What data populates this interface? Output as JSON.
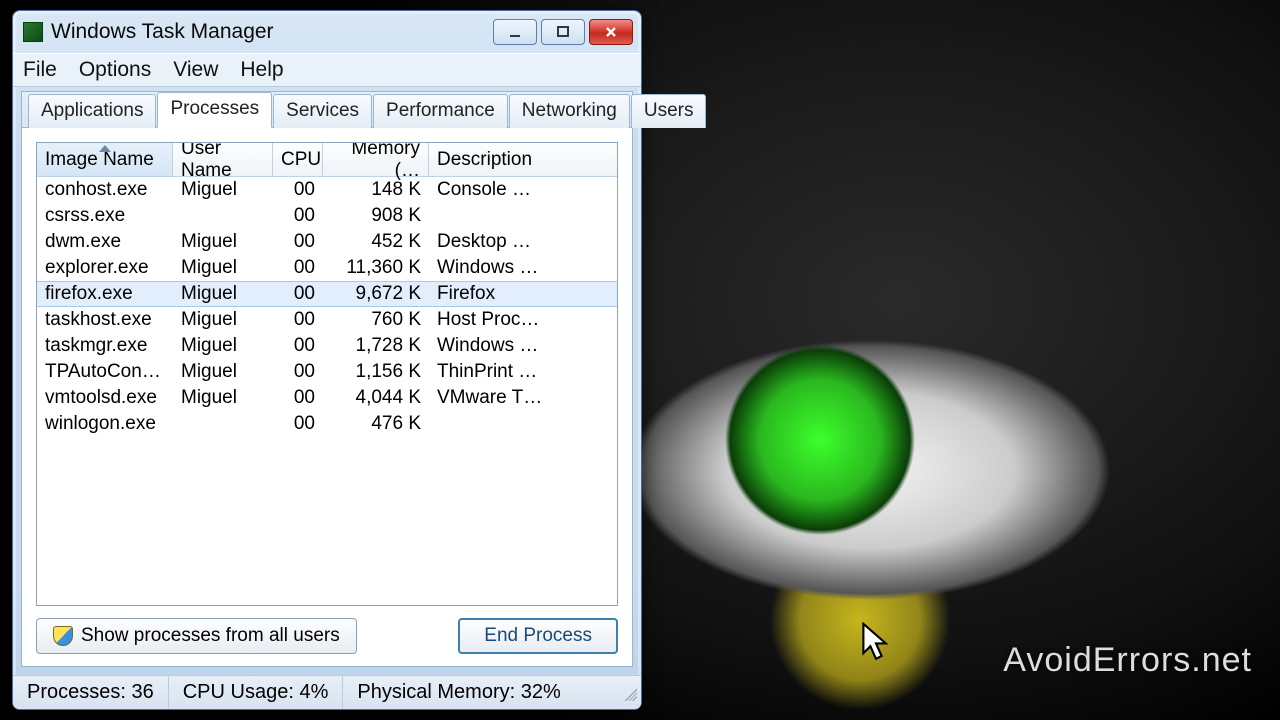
{
  "window": {
    "title": "Windows Task Manager"
  },
  "menu": {
    "file": "File",
    "options": "Options",
    "view": "View",
    "help": "Help"
  },
  "tabs": {
    "applications": "Applications",
    "processes": "Processes",
    "services": "Services",
    "performance": "Performance",
    "networking": "Networking",
    "users": "Users"
  },
  "columns": {
    "image": "Image Name",
    "user": "User Name",
    "cpu": "CPU",
    "memory": "Memory (…",
    "description": "Description"
  },
  "processes": [
    {
      "image": "conhost.exe",
      "user": "Miguel",
      "cpu": "00",
      "mem": "148 K",
      "desc": "Console …",
      "selected": false
    },
    {
      "image": "csrss.exe",
      "user": "",
      "cpu": "00",
      "mem": "908 K",
      "desc": "",
      "selected": false
    },
    {
      "image": "dwm.exe",
      "user": "Miguel",
      "cpu": "00",
      "mem": "452 K",
      "desc": "Desktop …",
      "selected": false
    },
    {
      "image": "explorer.exe",
      "user": "Miguel",
      "cpu": "00",
      "mem": "11,360 K",
      "desc": "Windows …",
      "selected": false
    },
    {
      "image": "firefox.exe",
      "user": "Miguel",
      "cpu": "00",
      "mem": "9,672 K",
      "desc": "Firefox",
      "selected": true
    },
    {
      "image": "taskhost.exe",
      "user": "Miguel",
      "cpu": "00",
      "mem": "760 K",
      "desc": "Host Proc…",
      "selected": false
    },
    {
      "image": "taskmgr.exe",
      "user": "Miguel",
      "cpu": "00",
      "mem": "1,728 K",
      "desc": "Windows …",
      "selected": false
    },
    {
      "image": "TPAutoConne…",
      "user": "Miguel",
      "cpu": "00",
      "mem": "1,156 K",
      "desc": "ThinPrint …",
      "selected": false
    },
    {
      "image": "vmtoolsd.exe",
      "user": "Miguel",
      "cpu": "00",
      "mem": "4,044 K",
      "desc": "VMware T…",
      "selected": false
    },
    {
      "image": "winlogon.exe",
      "user": "",
      "cpu": "00",
      "mem": "476 K",
      "desc": "",
      "selected": false
    }
  ],
  "buttons": {
    "show_all": "Show processes from all users",
    "end": "End Process"
  },
  "status": {
    "processes": "Processes: 36",
    "cpu": "CPU Usage: 4%",
    "mem": "Physical Memory: 32%"
  },
  "watermark": "AvoidErrors.net"
}
